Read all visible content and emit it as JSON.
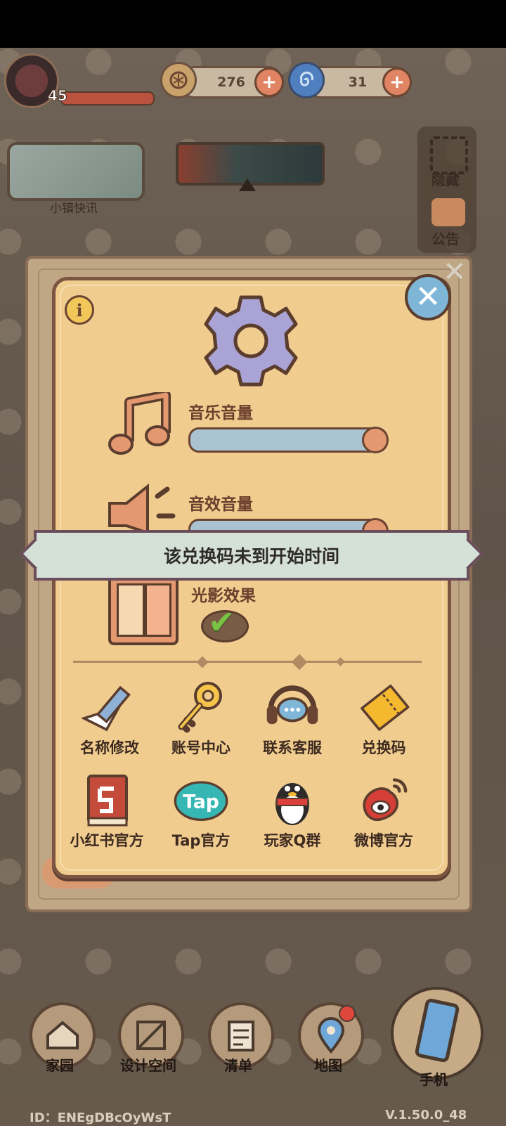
{
  "hud": {
    "level": "45",
    "currency1_value": "276",
    "currency2_value": "31"
  },
  "news": {
    "label": "小镇快讯"
  },
  "side": {
    "hide_label": "隐藏",
    "notice_label": "公告"
  },
  "settings": {
    "music_label": "音乐音量",
    "music_level": 1.0,
    "sfx_label": "音效音量",
    "sfx_level": 1.0,
    "light_label": "光影效果",
    "light_enabled": true,
    "grid": [
      {
        "label": "名称修改",
        "icon": "pencil-icon"
      },
      {
        "label": "账号中心",
        "icon": "key-icon"
      },
      {
        "label": "联系客服",
        "icon": "headset-icon"
      },
      {
        "label": "兑换码",
        "icon": "ticket-icon"
      },
      {
        "label": "小红书官方",
        "icon": "book-icon"
      },
      {
        "label": "Tap官方",
        "icon": "tap-icon"
      },
      {
        "label": "玩家Q群",
        "icon": "penguin-icon"
      },
      {
        "label": "微博官方",
        "icon": "weibo-icon"
      }
    ]
  },
  "toast": {
    "message": "该兑换码未到开始时间"
  },
  "bottom": {
    "home": "家园",
    "design": "设计空间",
    "list": "清单",
    "map": "地图",
    "phone": "手机"
  },
  "footer": {
    "id": "ID：ENEgDBcOyWsT",
    "version": "V.1.50.0_48"
  },
  "colors": {
    "panel": "#f0cc8f",
    "border": "#7b5541",
    "accent": "#e49870",
    "slider": "#a9c3d0",
    "toast": "#d5e0d6"
  }
}
